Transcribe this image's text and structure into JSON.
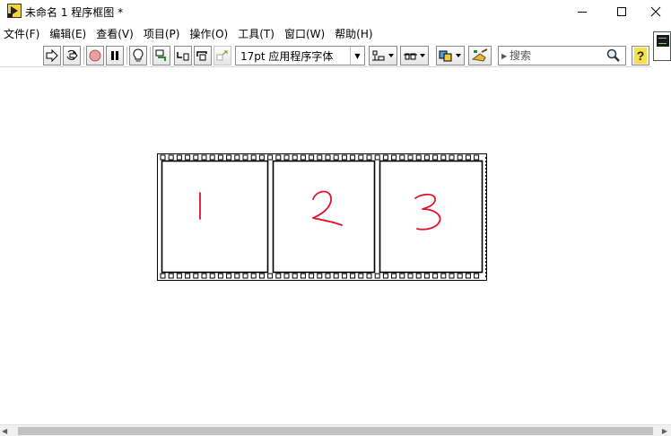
{
  "window": {
    "title": "未命名 1 程序框图 *"
  },
  "menu": [
    {
      "label": "文件(F)"
    },
    {
      "label": "编辑(E)"
    },
    {
      "label": "查看(V)"
    },
    {
      "label": "项目(P)"
    },
    {
      "label": "操作(O)"
    },
    {
      "label": "工具(T)"
    },
    {
      "label": "窗口(W)"
    },
    {
      "label": "帮助(H)"
    }
  ],
  "toolbar": {
    "font_value": "17pt 应用程序字体",
    "search_placeholder": "搜索"
  },
  "diagram": {
    "frames": [
      {
        "label": "1"
      },
      {
        "label": "2"
      },
      {
        "label": "3"
      }
    ],
    "annotation_color": "#e0122d"
  }
}
